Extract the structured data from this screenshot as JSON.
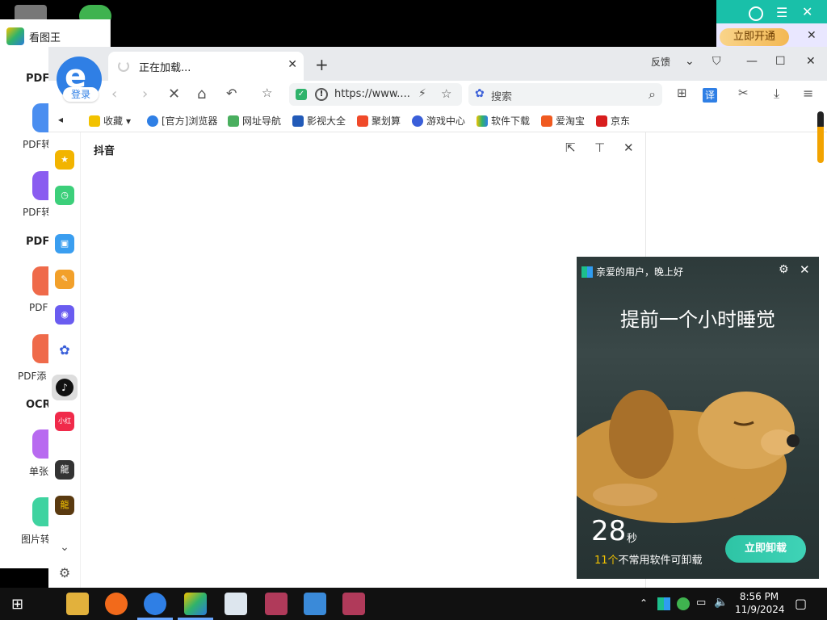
{
  "viewer": {
    "title": "看图王",
    "sections": [
      "PDF",
      "PDF",
      "OCR"
    ],
    "tools": [
      "PDF转",
      "PDF转",
      "PDF",
      "PDF添",
      "单张",
      "图片转"
    ]
  },
  "vip": {
    "button": "立即开通"
  },
  "avatar": {
    "login": "登录"
  },
  "browser": {
    "tab_title": "正在加载...",
    "feedback": "反馈",
    "url": "https://www....",
    "search_placeholder": "搜索",
    "translate": "译",
    "bookmarks": [
      "收藏",
      "[官方]浏览器",
      "网址导航",
      "影视大全",
      "聚划算",
      "游戏中心",
      "软件下载",
      "爱淘宝",
      "京东"
    ],
    "panel_title": "抖音"
  },
  "popup": {
    "greeting": "亲爱的用户，晚上好",
    "headline": "提前一个小时睡觉",
    "seconds": "28",
    "seconds_unit": "秒",
    "count": "11个",
    "count_text": "不常用软件可卸载",
    "uninstall": "立即卸载"
  },
  "taskbar": {
    "time": "8:56 PM",
    "date": "11/9/2024"
  },
  "colors": {
    "brand_blue": "#2f7fe5",
    "accent_teal": "#2ec4a5",
    "vip_gold": "#f3b853"
  }
}
